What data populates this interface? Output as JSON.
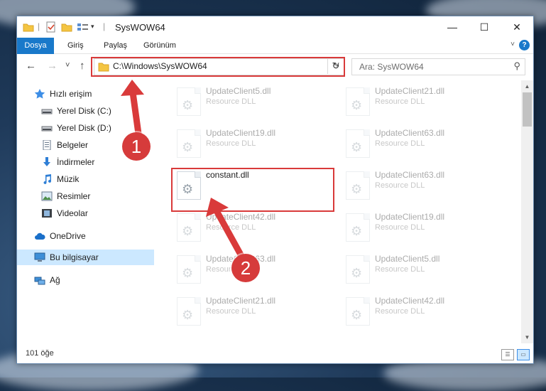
{
  "window": {
    "title": "SysWOW64",
    "minimize_glyph": "—",
    "maximize_glyph": "☐",
    "close_glyph": "✕"
  },
  "ribbon": {
    "tabs": [
      "Dosya",
      "Giriş",
      "Paylaş",
      "Görünüm"
    ],
    "help_glyph": "?"
  },
  "nav": {
    "back_glyph": "←",
    "forward_glyph": "→",
    "recent_glyph": "˅",
    "up_glyph": "↑",
    "address": "C:\\Windows\\SysWOW64",
    "address_dropdown_glyph": "˅",
    "refresh_glyph": "↻",
    "search_placeholder": "Ara: SysWOW64",
    "search_icon_glyph": "⚲"
  },
  "sidebar": {
    "quick_access": "Hızlı erişim",
    "items": [
      {
        "label": "Yerel Disk (C:)",
        "icon": "drive-icon",
        "pinned": true
      },
      {
        "label": "Yerel Disk (D:)",
        "icon": "drive-icon",
        "pinned": true
      },
      {
        "label": "Belgeler",
        "icon": "documents-icon",
        "pinned": true
      },
      {
        "label": "İndirmeler",
        "icon": "downloads-icon",
        "pinned": true
      },
      {
        "label": "Müzik",
        "icon": "music-icon",
        "pinned": true
      },
      {
        "label": "Resimler",
        "icon": "pictures-icon",
        "pinned": true
      },
      {
        "label": "Videolar",
        "icon": "videos-icon",
        "pinned": true
      }
    ],
    "onedrive": "OneDrive",
    "this_pc": "Bu bilgisayar",
    "network": "Ağ"
  },
  "files": {
    "left_column": [
      {
        "name": "UpdateClient5.dll",
        "type": "Resource DLL"
      },
      {
        "name": "UpdateClient19.dll",
        "type": "Resource DLL"
      },
      {
        "name": "constant.dll",
        "type": ""
      },
      {
        "name": "UpdateClient42.dll",
        "type": "Resource DLL"
      },
      {
        "name": "UpdateClient63.dll",
        "type": "Resource DLL"
      },
      {
        "name": "UpdateClient21.dll",
        "type": "Resource DLL"
      }
    ],
    "right_column": [
      {
        "name": "UpdateClient21.dll",
        "type": "Resource DLL"
      },
      {
        "name": "UpdateClient63.dll",
        "type": "Resource DLL"
      },
      {
        "name": "UpdateClient63.dll",
        "type": "Resource DLL"
      },
      {
        "name": "UpdateClient19.dll",
        "type": "Resource DLL"
      },
      {
        "name": "UpdateClient5.dll",
        "type": "Resource DLL"
      },
      {
        "name": "UpdateClient42.dll",
        "type": "Resource DLL"
      }
    ]
  },
  "status": {
    "item_count": "101 öğe"
  },
  "annotations": {
    "step1": "1",
    "step2": "2",
    "color": "#d93a3a"
  }
}
